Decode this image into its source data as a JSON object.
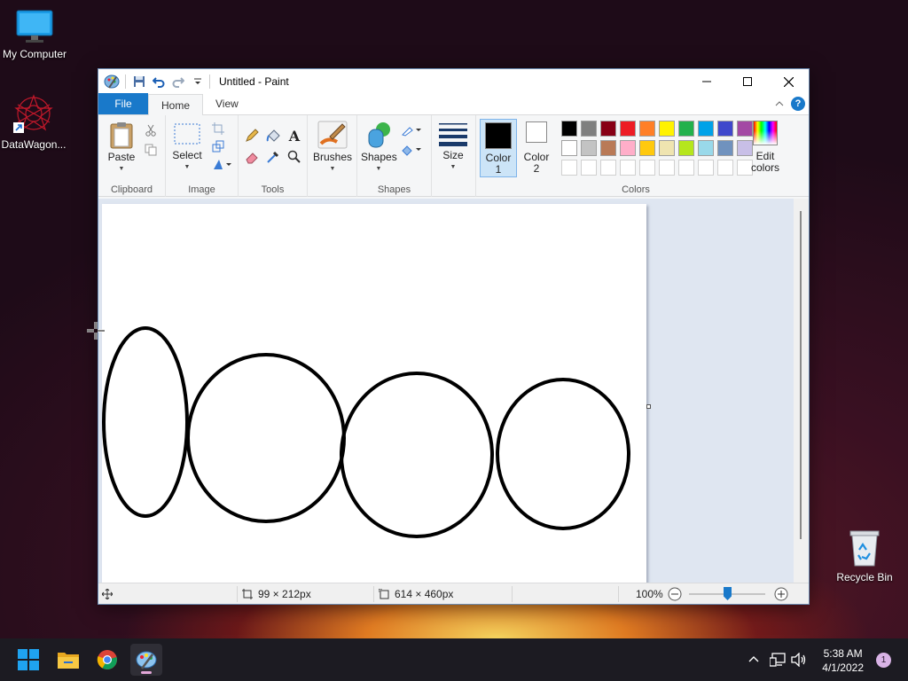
{
  "desktop": {
    "icons": [
      {
        "label": "My Computer"
      },
      {
        "label": "DataWagon..."
      },
      {
        "label": "Recycle Bin"
      }
    ]
  },
  "window": {
    "title": "Untitled - Paint",
    "tabs": [
      "File",
      "Home",
      "View"
    ],
    "ribbon": {
      "clipboard": {
        "paste": "Paste",
        "group": "Clipboard"
      },
      "image": {
        "select": "Select",
        "group": "Image"
      },
      "tools": {
        "group": "Tools"
      },
      "brushes": {
        "label": "Brushes"
      },
      "shapes": {
        "label": "Shapes",
        "group": "Shapes"
      },
      "size": {
        "label": "Size"
      },
      "color1": {
        "line1": "Color",
        "line2": "1"
      },
      "color2": {
        "line1": "Color",
        "line2": "2"
      },
      "colors_group": "Colors",
      "edit_colors": {
        "line1": "Edit",
        "line2": "colors"
      },
      "palette_row1": [
        "#000000",
        "#7f7f7f",
        "#880015",
        "#ed1c24",
        "#ff7f27",
        "#fff200",
        "#22b14c",
        "#00a2e8",
        "#3f48cc",
        "#a349a4"
      ],
      "palette_row2": [
        "#ffffff",
        "#c3c3c3",
        "#b97a57",
        "#ffaec9",
        "#ffc90e",
        "#efe4b0",
        "#b5e61d",
        "#99d9ea",
        "#7092be",
        "#c8bfe7"
      ]
    },
    "status": {
      "selection_size": "99 × 212px",
      "image_size": "614 × 460px",
      "zoom": "100%",
      "zoom_fraction": 0.5
    }
  },
  "taskbar": {
    "time": "5:38 AM",
    "date": "4/1/2022",
    "notifications": "1"
  }
}
